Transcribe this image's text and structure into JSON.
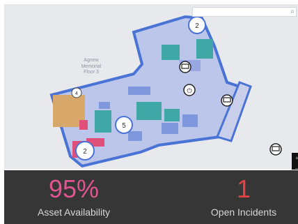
{
  "map": {
    "search": {
      "placeholder": ""
    },
    "labels": {
      "building": "Agnew Memorial",
      "floor": "Floor 3"
    },
    "clusters": [
      {
        "id": "north",
        "count": "2"
      },
      {
        "id": "center",
        "count": "5"
      },
      {
        "id": "southwest",
        "count": "2"
      },
      {
        "id": "west",
        "count": "4"
      }
    ],
    "markers": [
      "monitor-pin-icon",
      "power-pin-icon",
      "monitor-pin-icon",
      "monitor-pin-icon"
    ],
    "zoom": {
      "in": "+",
      "out": "–"
    },
    "colors": {
      "floor_outline": "#4a73d6",
      "floor_fill": "#bcc6ea",
      "room_teal": "#3fa7a5",
      "room_blue": "#7f97dd",
      "room_orange": "#d8a86a",
      "room_pink": "#e0507a"
    }
  },
  "stats": {
    "availability": {
      "value": "95%",
      "label": "Asset Availability",
      "color": "#e0558f"
    },
    "incidents": {
      "value": "1",
      "label": "Open Incidents",
      "color": "#e8413f"
    }
  }
}
